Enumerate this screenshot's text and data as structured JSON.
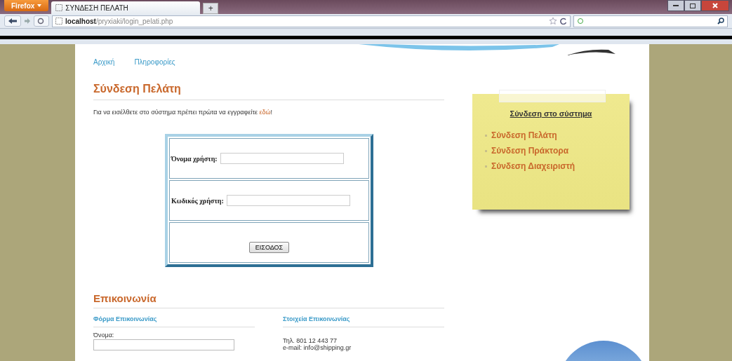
{
  "browser": {
    "menu_button": "Firefox",
    "tabs": [
      {
        "title": "ΣΥΝΔΕΣΗ ΠΕΛΑΤΗ",
        "selected": true
      }
    ],
    "new_tab": "+",
    "address": {
      "host": "localhost",
      "path": "/pryxiaki/login_pelati.php"
    }
  },
  "nav": [
    {
      "label": "Αρχική"
    },
    {
      "label": "Πληροφορίες"
    }
  ],
  "login": {
    "title": "Σύνδεση Πελάτη",
    "intro": "Για να εισέλθετε στο σύστημα πρέπει πρώτα να εγγραφείτε ",
    "intro_link": "εδώ",
    "intro_end": "!",
    "fields": [
      {
        "label": "Όνομα χρήστη:"
      },
      {
        "label": "Κωδικός χρήστη:"
      }
    ],
    "submit": "ΕΙΣΟΔΟΣ"
  },
  "sidebar": {
    "title": "Σύνδεση στο σύστημα",
    "items": [
      {
        "label": "Σύνδεση Πελάτη"
      },
      {
        "label": "Σύνδεση Πράκτορα"
      },
      {
        "label": "Σύνδεση Διαχειριστή"
      }
    ]
  },
  "contact": {
    "title": "Επικοινωνία",
    "form_title": "Φόρμα Επικοινωνίας",
    "name_label": "Όνομα:",
    "info_title": "Στοιχεία Επικοινωνίας",
    "phone": "Τηλ. 801 12 443 77",
    "email": "e-mail: info@shipping.gr"
  }
}
